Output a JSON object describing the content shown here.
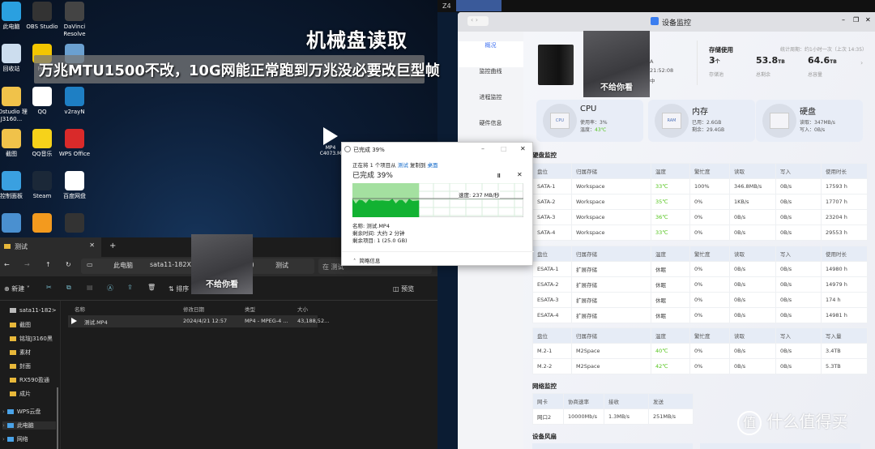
{
  "overlay": {
    "headline": "机械盘读取",
    "subtitle": "万兆MTU1500不改，10G网能正常跑到万兆没必要改巨型帧",
    "sticker_text": "不给你看"
  },
  "desktop": {
    "icons": [
      {
        "label": "此电脑",
        "color": "#2aa0e0"
      },
      {
        "label": "OBS Studio",
        "color": "#333"
      },
      {
        "label": "DaVinci Resolve",
        "color": "#444"
      },
      {
        "label": "回收站",
        "color": "#cde"
      },
      {
        "label": "Pot",
        "color": "#f3c600"
      },
      {
        "label": "",
        "color": "#6aa0d0"
      },
      {
        "label": "90studio 理J3160...",
        "color": "#f0c24a"
      },
      {
        "label": "QQ",
        "color": "#fff"
      },
      {
        "label": "v2rayN",
        "color": "#1e7fc4"
      },
      {
        "label": "截图",
        "color": "#f0c24a"
      },
      {
        "label": "QQ音乐",
        "color": "#f6d21a"
      },
      {
        "label": "WPS Office",
        "color": "#d92a2a"
      },
      {
        "label": "控制面板",
        "color": "#3aa0e0"
      },
      {
        "label": "Steam",
        "color": "#1b2838"
      },
      {
        "label": "百度网盘",
        "color": "#fff"
      },
      {
        "label": "",
        "color": "#4a90d0"
      },
      {
        "label": "",
        "color": "#f39a1e"
      },
      {
        "label": "",
        "color": "#333"
      }
    ],
    "file_icon": {
      "label1": "MP4",
      "label2": "C4073.M"
    }
  },
  "explorer": {
    "tab_label": "测试",
    "add_tab": "+",
    "address": [
      "此电脑",
      "sata11-182XXXX",
      "Z)",
      "测试"
    ],
    "search_placeholder": "在 测试",
    "toolbar": {
      "new": "新建",
      "sort": "排序",
      "more": "...",
      "preview": "预览"
    },
    "nav": [
      "sata11-182>",
      "截图",
      "铭瑄J3160黑",
      "素材",
      "封面",
      "RX590盈通",
      "成片"
    ],
    "nav_roots": [
      "WPS云盘",
      "此电脑",
      "网络"
    ],
    "columns": [
      "名称",
      "修改日期",
      "类型",
      "大小"
    ],
    "files": [
      {
        "name": "测试.MP4",
        "date": "2024/4/21 12:57",
        "type": "MP4 - MPEG-4 ...",
        "size": "43,188,52..."
      }
    ]
  },
  "copy_dialog": {
    "title": "已完成 39%",
    "line_prefix": "正在将 1 个项目从",
    "from": "测试",
    "mid": "复制到",
    "to": "桌面",
    "progress_label": "已完成 39%",
    "progress": 39,
    "speed": "速度: 237 MB/秒",
    "name": "名称: 测试.MP4",
    "time_left": "剩余时间: 大约 2 分钟",
    "items_left": "剩余项目: 1 (25.0 GB)",
    "less_info": "简略信息",
    "accent": "#06b025"
  },
  "monitor": {
    "title": "设备监控",
    "sidebar": [
      "概况",
      "监控曲线",
      "进程监控",
      "硬件信息"
    ],
    "device_partial": [
      "A",
      "21:52:08",
      "中"
    ],
    "storage": {
      "title": "存储使用",
      "period": "统计周期：约1小时一次（上次 14:35）",
      "pools": "3",
      "pools_unit": "个",
      "pools_label": "存储池",
      "free": "53.8",
      "free_unit": "TB",
      "free_label": "总剩余",
      "total": "64.6",
      "total_unit": "TB",
      "total_label": "总容量"
    },
    "cards": [
      {
        "title": "CPU",
        "l1": "使用率：3%",
        "l2k": "温度：",
        "l2v": "43℃",
        "chip": "CPU"
      },
      {
        "title": "内存",
        "l1": "已用：2.6GB",
        "l2k": "剩余：",
        "l2v": "29.4GB",
        "chip": "RAM"
      },
      {
        "title": "硬盘",
        "l1": "读取：347MB/s",
        "l2k": "写入：",
        "l2v": "0B/s",
        "chip": ""
      }
    ],
    "disk_section": "硬盘监控",
    "sata_header": [
      "盘位",
      "归属存储",
      "温度",
      "繁忙度",
      "读取",
      "写入",
      "使用时长"
    ],
    "sata": [
      [
        "SATA-1",
        "Workspace",
        "33℃",
        "100%",
        "346.8MB/s",
        "0B/s",
        "17593 h"
      ],
      [
        "SATA-2",
        "Workspace",
        "35℃",
        "0%",
        "1KB/s",
        "0B/s",
        "17707 h"
      ],
      [
        "SATA-3",
        "Workspace",
        "36℃",
        "0%",
        "0B/s",
        "0B/s",
        "23204 h"
      ],
      [
        "SATA-4",
        "Workspace",
        "33℃",
        "0%",
        "0B/s",
        "0B/s",
        "29553 h"
      ]
    ],
    "esata_header": [
      "盘位",
      "归属存储",
      "温度",
      "繁忙度",
      "读取",
      "写入",
      "使用时长"
    ],
    "esata": [
      [
        "ESATA-1",
        "扩展存储",
        "休眠",
        "0%",
        "0B/s",
        "0B/s",
        "14980 h"
      ],
      [
        "ESATA-2",
        "扩展存储",
        "休眠",
        "0%",
        "0B/s",
        "0B/s",
        "14979 h"
      ],
      [
        "ESATA-3",
        "扩展存储",
        "休眠",
        "0%",
        "0B/s",
        "0B/s",
        "174 h"
      ],
      [
        "ESATA-4",
        "扩展存储",
        "休眠",
        "0%",
        "0B/s",
        "0B/s",
        "14981 h"
      ]
    ],
    "m2_header": [
      "盘位",
      "归属存储",
      "温度",
      "繁忙度",
      "读取",
      "写入",
      "写入量"
    ],
    "m2": [
      [
        "M.2-1",
        "M2Space",
        "40℃",
        "0%",
        "0B/s",
        "0B/s",
        "3.4TB"
      ],
      [
        "M.2-2",
        "M2Space",
        "42℃",
        "0%",
        "0B/s",
        "0B/s",
        "5.3TB"
      ]
    ],
    "net_section": "网络监控",
    "net_header": [
      "网卡",
      "协商速率",
      "接收",
      "发送"
    ],
    "net": [
      [
        "网口2",
        "10000Mb/s",
        "1.3MB/s",
        "251MB/s"
      ]
    ],
    "fan_section": "设备风扇"
  },
  "topbar": {
    "text": "Z4"
  },
  "watermark": {
    "logo": "值",
    "text": "什么值得买"
  }
}
